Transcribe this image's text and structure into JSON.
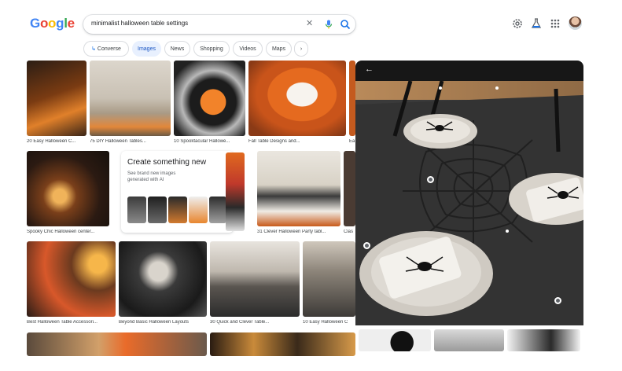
{
  "header": {
    "logo_letters": [
      "G",
      "o",
      "o",
      "g",
      "l",
      "e"
    ],
    "search_query": "minimalist halloween table settings"
  },
  "icons": {
    "clear": "close-icon",
    "mic": "microphone-icon",
    "lens": "search-icon",
    "settings": "gear-icon",
    "labs": "flask-icon",
    "apps": "apps-grid-icon"
  },
  "chips": [
    {
      "label": "Converse"
    },
    {
      "label": "Images"
    },
    {
      "label": "News"
    },
    {
      "label": "Shopping"
    },
    {
      "label": "Videos"
    },
    {
      "label": "Maps"
    },
    {
      "label": "›"
    }
  ],
  "results_row1": [
    {
      "caption": "20 Easy Halloween C..."
    },
    {
      "caption": "75 DIY Halloween Tables..."
    },
    {
      "caption": "10 Spooktacular Hallowe..."
    },
    {
      "caption": "Fall Table Designs and..."
    },
    {
      "caption": "Ea"
    }
  ],
  "results_row2": [
    {
      "caption": "Spooky Chic Halloween center..."
    },
    {
      "caption": "31 Clever Halloween Party tabl..."
    },
    {
      "caption": "Clas"
    }
  ],
  "results_row3": [
    {
      "caption": "Best Halloween Table Accessori..."
    },
    {
      "caption": "Beyond Basic Halloween Layouts"
    },
    {
      "caption": "30 Quick and Clever Table..."
    },
    {
      "caption": "10 Easy Halloween C"
    }
  ],
  "ai_card": {
    "title": "Create something new",
    "subtitle": "See brand new images generated with AI"
  },
  "panel": {
    "back_label": "←"
  },
  "colors": {
    "accent": "#1a73e8",
    "chip_active_bg": "#e8f0fe",
    "panel_header": "#171717"
  }
}
